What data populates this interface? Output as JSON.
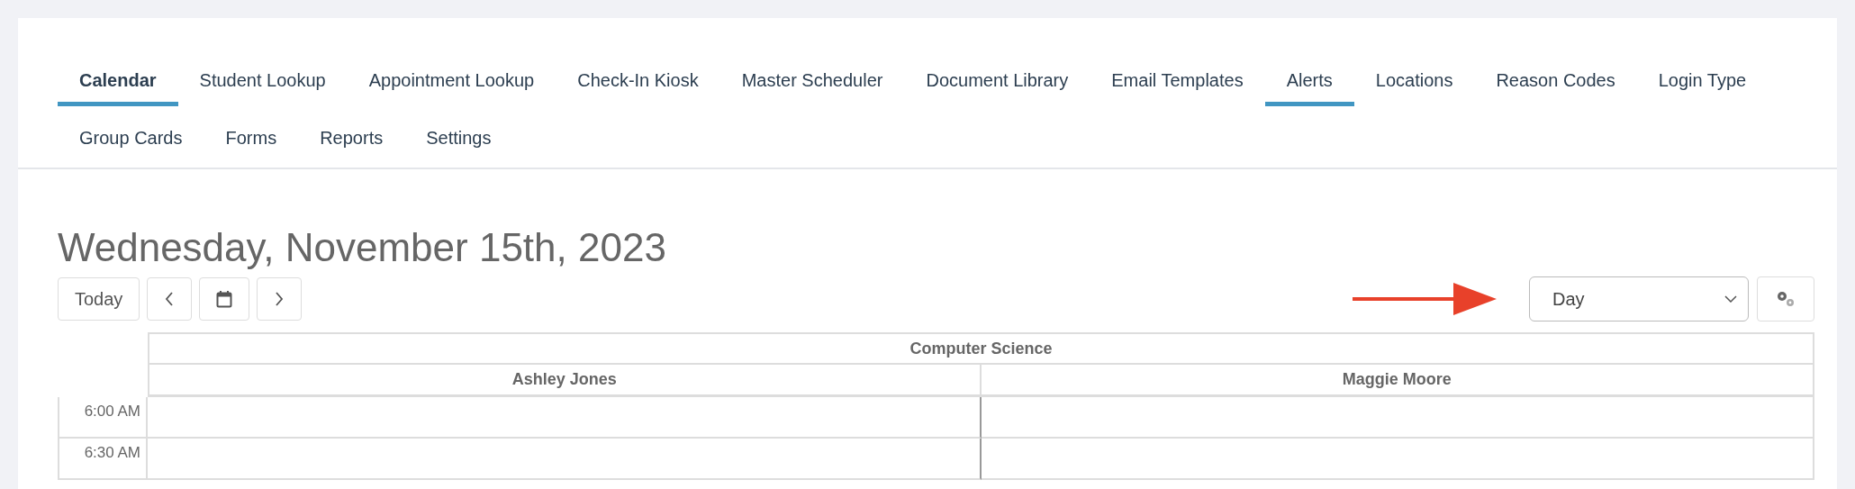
{
  "nav": {
    "tabs": [
      {
        "label": "Calendar",
        "selected": true,
        "hovered": false
      },
      {
        "label": "Student Lookup",
        "selected": false,
        "hovered": false
      },
      {
        "label": "Appointment Lookup",
        "selected": false,
        "hovered": false
      },
      {
        "label": "Check-In Kiosk",
        "selected": false,
        "hovered": false
      },
      {
        "label": "Master Scheduler",
        "selected": false,
        "hovered": false
      },
      {
        "label": "Document Library",
        "selected": false,
        "hovered": false
      },
      {
        "label": "Email Templates",
        "selected": false,
        "hovered": false
      },
      {
        "label": "Alerts",
        "selected": false,
        "hovered": true
      },
      {
        "label": "Locations",
        "selected": false,
        "hovered": false
      },
      {
        "label": "Reason Codes",
        "selected": false,
        "hovered": false
      },
      {
        "label": "Login Type",
        "selected": false,
        "hovered": false
      },
      {
        "label": "Group Cards",
        "selected": false,
        "hovered": false
      },
      {
        "label": "Forms",
        "selected": false,
        "hovered": false
      },
      {
        "label": "Reports",
        "selected": false,
        "hovered": false
      },
      {
        "label": "Settings",
        "selected": false,
        "hovered": false
      }
    ]
  },
  "date_title": "Wednesday, November 15th, 2023",
  "toolbar": {
    "today_button": "Today",
    "view_select": {
      "value": "Day"
    }
  },
  "calendar": {
    "group": "Computer Science",
    "columns": [
      "Ashley Jones",
      "Maggie Moore"
    ],
    "times": [
      "6:00 AM",
      "6:30 AM"
    ]
  }
}
